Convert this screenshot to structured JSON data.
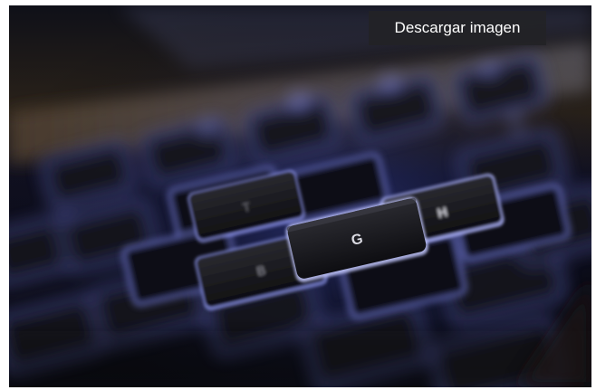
{
  "image": {
    "alt": "Primer plano de un teclado retroiluminado",
    "keys": {
      "center": "G",
      "right": "H",
      "left_top": "T",
      "left_bottom": "B"
    }
  },
  "actions": {
    "download_label": "Descargar imagen"
  },
  "colors": {
    "backlight": "#6f7cff",
    "key_face": "#141418",
    "button_bg": "#232326"
  }
}
